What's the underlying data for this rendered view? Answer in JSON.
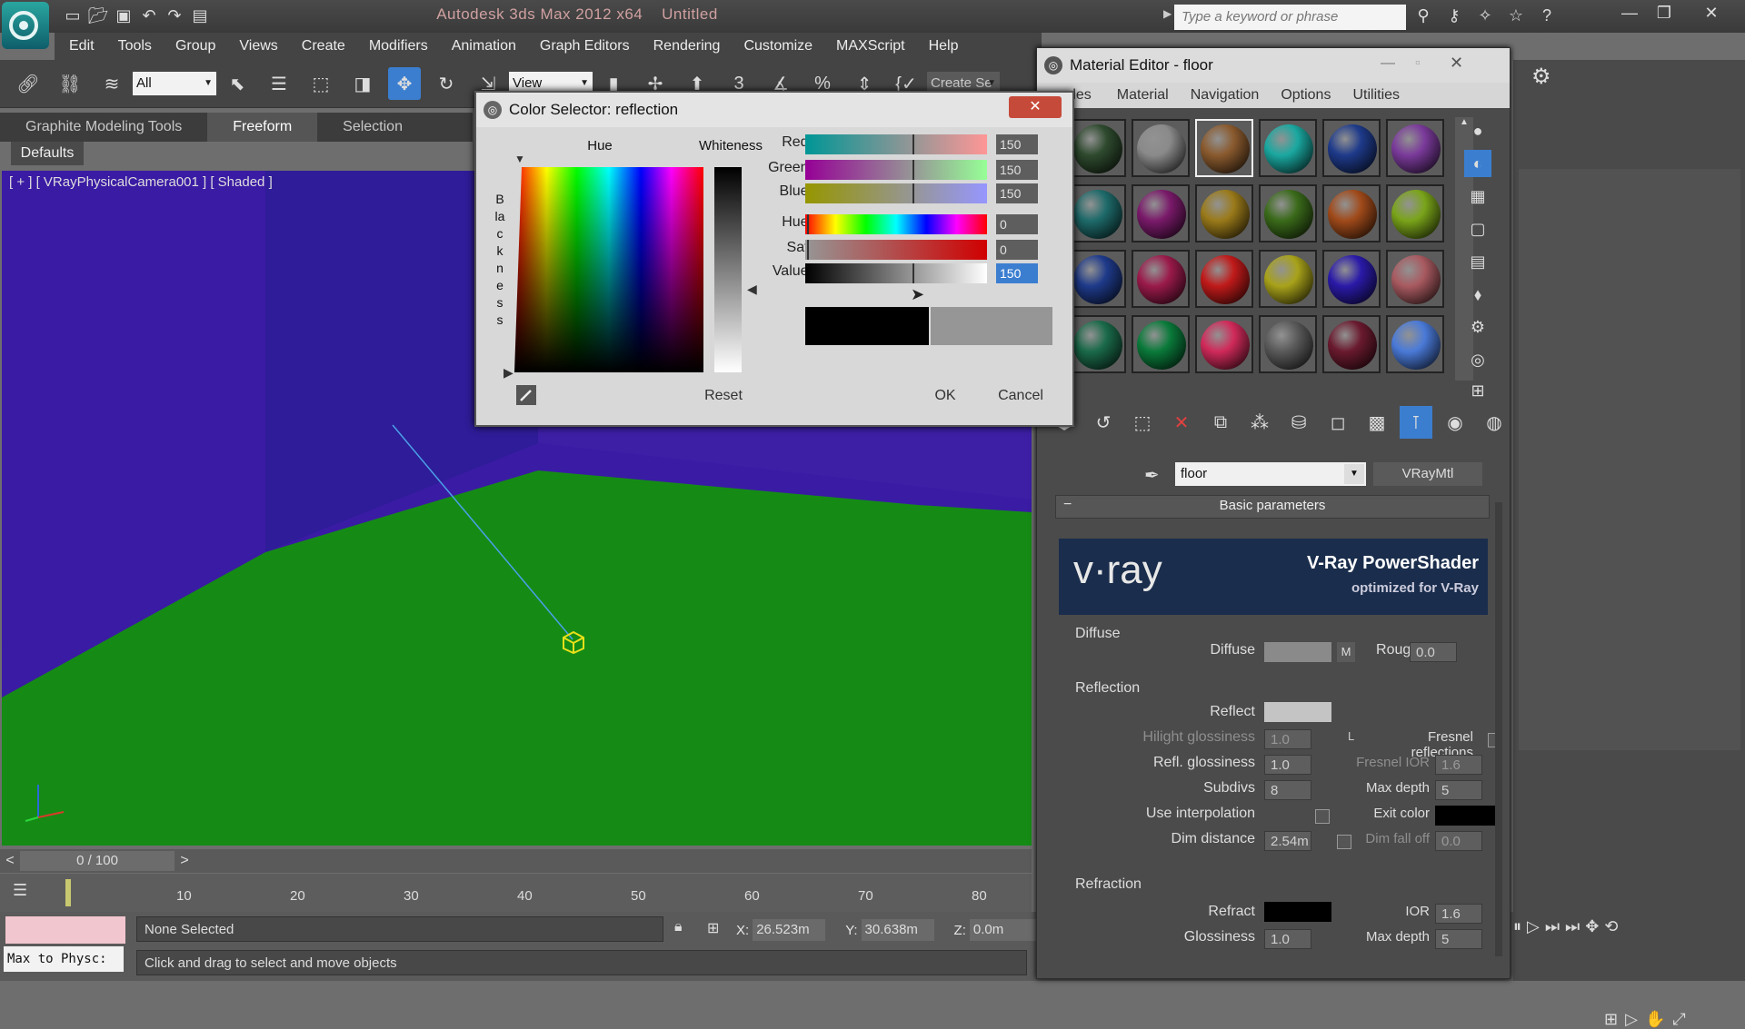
{
  "app": {
    "title": "Autodesk 3ds Max 2012 x64",
    "doc_title": "Untitled",
    "search_placeholder": "Type a keyword or phrase"
  },
  "menubar": [
    "Edit",
    "Tools",
    "Group",
    "Views",
    "Create",
    "Modifiers",
    "Animation",
    "Graph Editors",
    "Rendering",
    "Customize",
    "MAXScript",
    "Help"
  ],
  "toolbar": {
    "filter_value": "All",
    "refcoord_value": "View",
    "snap_label": "3",
    "create_sel_label": "Create Se"
  },
  "ribbon": {
    "tabs": [
      "Graphite Modeling Tools",
      "Freeform",
      "Selection"
    ],
    "active": "Freeform",
    "defaults": "Defaults"
  },
  "viewport": {
    "label": "[ + ] [ VRayPhysicalCamera001 ] [ Shaded ]"
  },
  "timeline": {
    "frame": "0 / 100",
    "ticks": [
      "10",
      "20",
      "30",
      "40",
      "50",
      "60",
      "70",
      "80"
    ]
  },
  "status": {
    "max_to_phys": "Max to Physc:",
    "selection": "None Selected",
    "prompt": "Click and drag to select and move objects",
    "x_label": "X:",
    "x_value": "26.523m",
    "y_label": "Y:",
    "y_value": "30.638m",
    "z_label": "Z:",
    "z_value": "0.0m"
  },
  "material_editor": {
    "title": "Material Editor - floor",
    "menu": [
      "des",
      "Material",
      "Navigation",
      "Options",
      "Utilities"
    ],
    "material_name": "floor",
    "material_type": "VRayMtl",
    "rollout": "Basic parameters",
    "banner_logo": "v·ray",
    "banner_title": "V-Ray PowerShader",
    "banner_sub": "optimized for V-Ray",
    "diffuse": {
      "group": "Diffuse",
      "label": "Diffuse",
      "m": "M",
      "roughness_label": "Roughness",
      "roughness": "0.0"
    },
    "reflection": {
      "group": "Reflection",
      "reflect_label": "Reflect",
      "hilight_label": "Hilight glossiness",
      "hilight": "1.0",
      "l": "L",
      "fresnel_label": "Fresnel reflections",
      "refl_gloss_label": "Refl. glossiness",
      "refl_gloss": "1.0",
      "fresnel_ior_label": "Fresnel IOR",
      "fresnel_ior": "1.6",
      "subdivs_label": "Subdivs",
      "subdivs": "8",
      "max_depth_label": "Max depth",
      "max_depth": "5",
      "use_interp_label": "Use interpolation",
      "exit_color_label": "Exit color",
      "dim_dist_label": "Dim distance",
      "dim_dist": "2.54m",
      "dim_falloff_label": "Dim fall off",
      "dim_falloff": "0.0"
    },
    "refraction": {
      "group": "Refraction",
      "refract_label": "Refract",
      "ior_label": "IOR",
      "ior": "1.6",
      "gloss_label": "Glossiness",
      "gloss": "1.0",
      "max_depth_label": "Max depth",
      "max_depth": "5"
    },
    "sample_colors": [
      "#2e4a2e",
      "#8a8a8a",
      "#8a5a2e",
      "#1aa8a0",
      "#1e3a8a",
      "#7a3a9a",
      "#1e6a6a",
      "#7a1a6a",
      "#9a7a1a",
      "#3a6a1a",
      "#a04a1a",
      "#7aa41a",
      "#1e3a8a",
      "#9a1a4a",
      "#c01a1a",
      "#a8a21a",
      "#2a1aa8",
      "#a85a60",
      "#1a6a4a",
      "#0a7a3a",
      "#d02a5a",
      "#5a5a5a",
      "#6a1a2e",
      "#4a7ad8"
    ]
  },
  "color_selector": {
    "title": "Color Selector: reflection",
    "hue_label": "Hue",
    "whiteness_label": "Whiteness",
    "blackness_label": "Blackness",
    "red_label": "Red:",
    "red": "150",
    "green_label": "Green:",
    "green": "150",
    "blue_label": "Blue:",
    "blue": "150",
    "hue_s_label": "Hue:",
    "hue": "0",
    "sat_label": "Sat:",
    "sat": "0",
    "value_label": "Value:",
    "value": "150",
    "reset": "Reset",
    "ok": "OK",
    "cancel": "Cancel",
    "old_color": "#000000",
    "new_color": "#969696"
  }
}
